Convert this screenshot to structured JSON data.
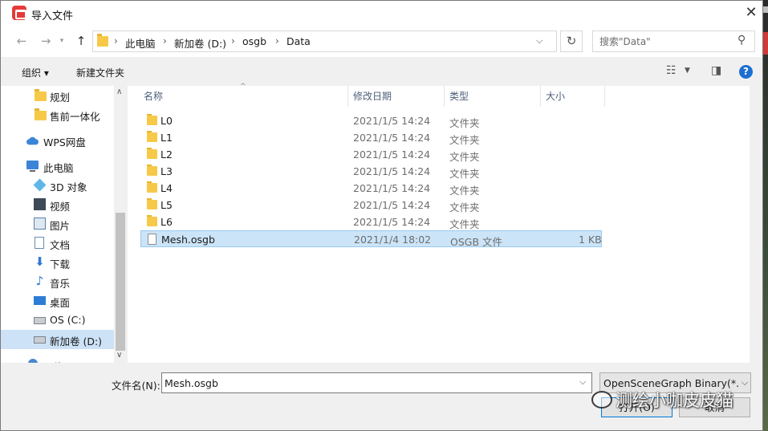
{
  "window": {
    "title": "导入文件",
    "close_glyph": "✕"
  },
  "navigation": {
    "back_glyph": "←",
    "forward_glyph": "→",
    "up_glyph": "↑",
    "breadcrumbs": [
      "此电脑",
      "新加卷 (D:)",
      "osgb",
      "Data"
    ],
    "refresh_glyph": "↻",
    "search_placeholder": "搜索\"Data\""
  },
  "toolbar": {
    "organize_label": "组织 ▾",
    "new_folder_label": "新建文件夹"
  },
  "sidebar": {
    "items": [
      {
        "label": "规划",
        "icon": "folder-icon"
      },
      {
        "label": "售前一体化",
        "icon": "folder-icon"
      },
      {
        "label": "WPS网盘",
        "icon": "cloud-icon"
      },
      {
        "label": "此电脑",
        "icon": "computer-icon"
      },
      {
        "label": "3D 对象",
        "icon": "3d-objects-icon"
      },
      {
        "label": "视频",
        "icon": "video-icon"
      },
      {
        "label": "图片",
        "icon": "pictures-icon"
      },
      {
        "label": "文档",
        "icon": "documents-icon"
      },
      {
        "label": "下载",
        "icon": "download-icon"
      },
      {
        "label": "音乐",
        "icon": "music-icon"
      },
      {
        "label": "桌面",
        "icon": "desktop-icon"
      },
      {
        "label": "OS (C:)",
        "icon": "drive-icon"
      },
      {
        "label": "新加卷 (D:)",
        "icon": "drive-icon",
        "selected": true
      },
      {
        "label": "网络",
        "icon": "network-icon"
      }
    ]
  },
  "file_list": {
    "columns": [
      "名称",
      "修改日期",
      "类型",
      "大小"
    ],
    "rows": [
      {
        "name": "L0",
        "date": "2021/1/5 14:24",
        "type": "文件夹",
        "size": "",
        "kind": "folder"
      },
      {
        "name": "L1",
        "date": "2021/1/5 14:24",
        "type": "文件夹",
        "size": "",
        "kind": "folder"
      },
      {
        "name": "L2",
        "date": "2021/1/5 14:24",
        "type": "文件夹",
        "size": "",
        "kind": "folder"
      },
      {
        "name": "L3",
        "date": "2021/1/5 14:24",
        "type": "文件夹",
        "size": "",
        "kind": "folder"
      },
      {
        "name": "L4",
        "date": "2021/1/5 14:24",
        "type": "文件夹",
        "size": "",
        "kind": "folder"
      },
      {
        "name": "L5",
        "date": "2021/1/5 14:24",
        "type": "文件夹",
        "size": "",
        "kind": "folder"
      },
      {
        "name": "L6",
        "date": "2021/1/5 14:24",
        "type": "文件夹",
        "size": "",
        "kind": "folder"
      },
      {
        "name": "Mesh.osgb",
        "date": "2021/1/4 18:02",
        "type": "OSGB 文件",
        "size": "1 KB",
        "kind": "file",
        "selected": true
      }
    ]
  },
  "bottom": {
    "filename_label": "文件名(N):",
    "filename_value": "Mesh.osgb",
    "filetype_value": "OpenSceneGraph Binary(*.osgb)",
    "open_label": "打开(O)",
    "cancel_label": "取消"
  },
  "watermark": {
    "text": "测绘小咖皮皮猫"
  },
  "colors": {
    "selection": "#cce4f7",
    "accent": "#0078d7",
    "folder": "#f7c948"
  }
}
